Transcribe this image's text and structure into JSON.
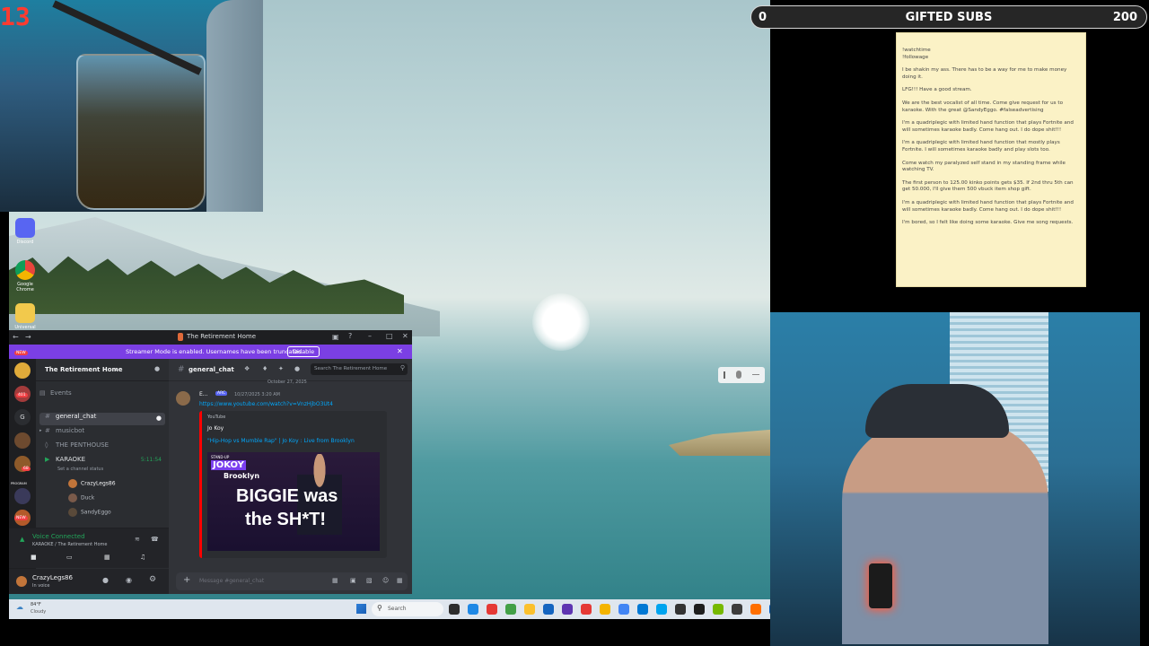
{
  "stream": {
    "counter_prefix": "",
    "counter_value": "13",
    "subs_bar": {
      "left": "0",
      "title": "GIFTED SUBS",
      "right": "200"
    }
  },
  "desktop_icons": [
    {
      "label": "Discord",
      "color": "#5865f2"
    },
    {
      "label": "Google Chrome",
      "color": "#e8453c"
    },
    {
      "label": "Universal",
      "color": "#f2c94c"
    }
  ],
  "notes": [
    "!watchtime\n!followage",
    "I be shakin my ass. There has to be a way for me to make money doing it.",
    "LFG!!! Have a good stream.",
    "We are the best vocalist of all time. Come give request for us to karaoke. With the great @SandyEggo. #falseadvertising",
    "I'm a quadriplegic with limited hand function that plays Fortnite and will sometimes karaoke badly. Come hang out. I do dope shit!!!",
    "I'm a quadriplegic with limited hand function that mostly plays Fortnite. I will sometimes karaoke badly and play slots too.",
    "Come watch my paralyzed self stand in my standing frame while watching TV.",
    "The first person to 125.00 kinko points gets $35. If 2nd thru 5th can get 50.000, I'll give them 500 vbuck item shop gift.",
    "I'm a quadriplegic with limited hand function that plays Fortnite and will sometimes karaoke badly. Come hang out. I do dope shit!!!",
    "I'm bored, so I felt like doing some karaoke. Give me song requests."
  ],
  "discord": {
    "window_title": "The Retirement Home",
    "banner_text": "Streamer Mode is enabled. Usernames have been truncated.",
    "banner_button": "Disable",
    "server_name": "The Retirement Home",
    "guild_badges": [
      "NEW",
      "401",
      "G",
      "68",
      "PROGRAM",
      "NEW"
    ],
    "events_label": "Events",
    "channels": [
      {
        "name": "general_chat",
        "type": "#",
        "active": true
      },
      {
        "name": "musicbot",
        "type": "#",
        "active": false
      },
      {
        "name": "THE PENTHOUSE",
        "type": "",
        "active": false
      },
      {
        "name": "KARAOKE",
        "type": "voice",
        "active": false,
        "time": "5:11:54"
      }
    ],
    "channel_status_hint": "Set a channel status",
    "voice_users": [
      "CrazyLegs86",
      "Duck",
      "SandyEggo"
    ],
    "voice_connected": "Voice Connected",
    "voice_location": "KARAOKE / The Retirement Home",
    "user": {
      "name": "CrazyLegs86",
      "status": "In voice"
    },
    "chat": {
      "channel": "general_chat",
      "search_placeholder": "Search The Retirement Home",
      "date_divider": "October 27, 2025",
      "author": "E...",
      "author_tag": "ARC",
      "timestamp": "10/27/2025 3:20 AM",
      "link": "https://www.youtube.com/watch?v=VnzHjbO3Ut4",
      "embed_provider": "YouTube",
      "embed_author": "Jo Koy",
      "embed_title": "\"Hip-Hop vs Mumble Rap\" | Jo Koy : Live from Brooklyn",
      "thumb_brand_top": "STAND-UP",
      "thumb_brand": "JOKOY",
      "thumb_brand_sub": "Brooklyn",
      "thumb_line1": "BIGGIE was",
      "thumb_line2": "the SH*T!",
      "message_placeholder": "Message #general_chat"
    }
  },
  "taskbar": {
    "weather_temp": "84°F",
    "weather_desc": "Cloudy",
    "search_placeholder": "Search",
    "app_colors": [
      "#2d2d2d",
      "#1e88e5",
      "#e53935",
      "#43a047",
      "#fbc02d",
      "#1565c0",
      "#5e35b1",
      "#e53935",
      "#f4b400",
      "#4285f4",
      "#0078d4",
      "#00a4ef",
      "#333333",
      "#1e1e1e",
      "#76b900",
      "#3c3c3c",
      "#ff6f00",
      "#0057b8"
    ]
  }
}
